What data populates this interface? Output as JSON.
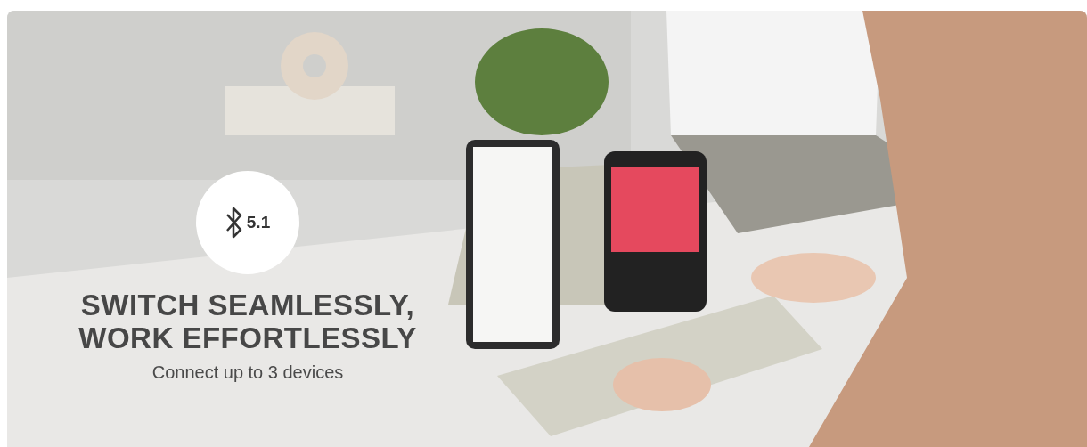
{
  "banner": {
    "badge": {
      "text": "5.1"
    },
    "headline": [
      "SWITCH SEAMLESSLY,",
      "WORK EFFORTLESSLY"
    ],
    "subtitle": "Connect up to 3 devices"
  }
}
